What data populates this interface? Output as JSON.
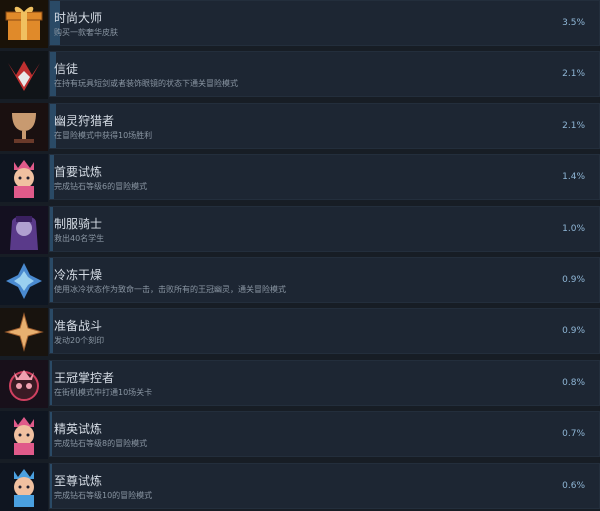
{
  "achievements": [
    {
      "title": "时尚大师",
      "desc": "购买一款奢华皮肤",
      "percent": "3.5%",
      "rate": 0.035,
      "icon": "gift-box-icon",
      "colors": [
        "#e08a2a",
        "#8a4a14"
      ]
    },
    {
      "title": "信徒",
      "desc": "在持有玩具短剑或者装饰眼镜的状态下通关冒险模式",
      "percent": "2.1%",
      "rate": 0.021,
      "icon": "crown-shard-icon",
      "colors": [
        "#c03030",
        "#e8e8e8"
      ]
    },
    {
      "title": "幽灵狩猎者",
      "desc": "在冒险模式中获得10场胜利",
      "percent": "2.1%",
      "rate": 0.021,
      "icon": "trophy-cup-icon",
      "colors": [
        "#c89a70",
        "#6a3a2a"
      ]
    },
    {
      "title": "首要试炼",
      "desc": "完成钻石等级6的冒险模式",
      "percent": "1.4%",
      "rate": 0.014,
      "icon": "princess-character-icon",
      "colors": [
        "#e05a8a",
        "#f0c0a0"
      ]
    },
    {
      "title": "制服骑士",
      "desc": "救出40名学生",
      "percent": "1.0%",
      "rate": 0.01,
      "icon": "knight-character-icon",
      "colors": [
        "#5a3a8a",
        "#b0a0d0"
      ]
    },
    {
      "title": "冷冻干燥",
      "desc": "使用冰冷状态作为致命一击，击败所有的王冠幽灵，通关冒险模式",
      "percent": "0.9%",
      "rate": 0.009,
      "icon": "ice-crystal-icon",
      "colors": [
        "#4a8ad0",
        "#9ad0f0"
      ]
    },
    {
      "title": "准备战斗",
      "desc": "发动20个刻印",
      "percent": "0.9%",
      "rate": 0.009,
      "icon": "star-sigil-icon",
      "colors": [
        "#e8b070",
        "#a06030"
      ]
    },
    {
      "title": "王冠掌控者",
      "desc": "在街机模式中打通10场关卡",
      "percent": "0.8%",
      "rate": 0.008,
      "icon": "crowned-ghost-icon",
      "colors": [
        "#d04060",
        "#f0a0b0"
      ]
    },
    {
      "title": "精英试炼",
      "desc": "完成钻石等级8的冒险模式",
      "percent": "0.7%",
      "rate": 0.007,
      "icon": "princess-character-icon",
      "colors": [
        "#e05a8a",
        "#f0c0a0"
      ]
    },
    {
      "title": "至尊试炼",
      "desc": "完成钻石等级10的冒险模式",
      "percent": "0.6%",
      "rate": 0.006,
      "icon": "princess-character-icon",
      "colors": [
        "#4aa0e0",
        "#f0c0a0"
      ]
    }
  ]
}
